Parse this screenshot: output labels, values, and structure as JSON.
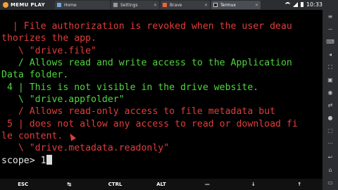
{
  "app": {
    "name": "MEMU PLAY"
  },
  "tabs": [
    {
      "label": "Home",
      "active": false
    },
    {
      "label": "Settings",
      "active": false
    },
    {
      "label": "Brave",
      "active": false
    },
    {
      "label": "Termux",
      "active": true
    }
  ],
  "status": {
    "time": "10:33"
  },
  "terminal": {
    "lines": [
      {
        "text": "  | File authorization is revoked when the user deau",
        "color": "red"
      },
      {
        "text": "thorizes the app.",
        "color": "red"
      },
      {
        "text": "   \\ \"drive.file\"",
        "color": "red"
      },
      {
        "text": "   / Allows read and write access to the Application",
        "color": "green"
      },
      {
        "text": "Data folder.",
        "color": "green"
      },
      {
        "text": " 4 | This is not visible in the drive website.",
        "color": "green"
      },
      {
        "text": "   \\ \"drive.appfolder\"",
        "color": "green"
      },
      {
        "text": "   / Allows read-only access to file metadata but",
        "color": "red"
      },
      {
        "text": " 5 | does not allow any access to read or download fi",
        "color": "red"
      },
      {
        "text": "le content.",
        "color": "red"
      },
      {
        "text": "   \\ \"drive.metadata.readonly\"",
        "color": "red"
      }
    ],
    "prompt": "scope> 1"
  },
  "extra_keys": [
    "ESC",
    "↹",
    "CTRL",
    "ALT",
    "—",
    "↓",
    "↑"
  ],
  "colors": {
    "red": "#e23c3c",
    "green": "#4fd63c",
    "bg": "#000000"
  }
}
